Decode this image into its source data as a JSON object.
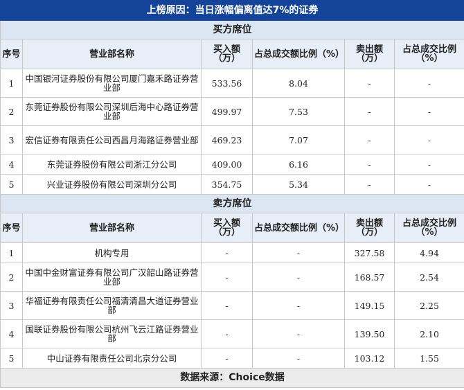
{
  "title": "上榜原因：当日涨幅偏离值达7%的证券",
  "columns": [
    "序号",
    "营业部名称",
    "买入额（万）",
    "占总成交额比例（%）",
    "卖出额（万）",
    "占总成交比例（%）"
  ],
  "buy": {
    "section_label": "买方席位",
    "rows": [
      {
        "idx": "1",
        "name": "中国银河证券股份有限公司厦门嘉禾路证券营业部",
        "buy": "533.56",
        "buy_pct": "8.04",
        "sell": "-",
        "sell_pct": "-"
      },
      {
        "idx": "2",
        "name": "东莞证券股份有限公司深圳后海中心路证券营业部",
        "buy": "499.97",
        "buy_pct": "7.53",
        "sell": "-",
        "sell_pct": "-"
      },
      {
        "idx": "3",
        "name": "宏信证券有限责任公司西昌月海路证券营业部",
        "buy": "469.23",
        "buy_pct": "7.07",
        "sell": "-",
        "sell_pct": "-"
      },
      {
        "idx": "4",
        "name": "东莞证券股份有限公司浙江分公司",
        "buy": "409.00",
        "buy_pct": "6.16",
        "sell": "-",
        "sell_pct": "-"
      },
      {
        "idx": "5",
        "name": "兴业证券股份有限公司深圳分公司",
        "buy": "354.75",
        "buy_pct": "5.34",
        "sell": "-",
        "sell_pct": "-"
      }
    ]
  },
  "sell": {
    "section_label": "卖方席位",
    "rows": [
      {
        "idx": "1",
        "name": "机构专用",
        "buy": "-",
        "buy_pct": "-",
        "sell": "327.58",
        "sell_pct": "4.94"
      },
      {
        "idx": "2",
        "name": "中国中金财富证券有限公司广汉韶山路证券营业部",
        "buy": "-",
        "buy_pct": "-",
        "sell": "168.57",
        "sell_pct": "2.54"
      },
      {
        "idx": "3",
        "name": "华福证券有限责任公司福清清昌大道证券营业部",
        "buy": "-",
        "buy_pct": "-",
        "sell": "149.15",
        "sell_pct": "2.25"
      },
      {
        "idx": "4",
        "name": "国联证券股份有限公司杭州飞云江路证券营业部",
        "buy": "-",
        "buy_pct": "-",
        "sell": "139.50",
        "sell_pct": "2.10"
      },
      {
        "idx": "5",
        "name": "中山证券有限责任公司北京分公司",
        "buy": "-",
        "buy_pct": "-",
        "sell": "103.12",
        "sell_pct": "1.55"
      }
    ]
  },
  "footer": "数据来源：Choice数据"
}
